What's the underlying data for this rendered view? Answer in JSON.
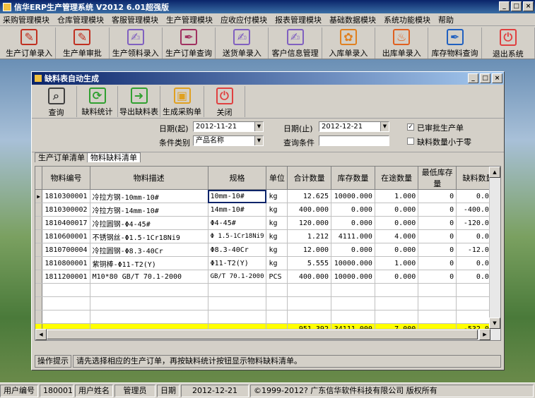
{
  "app": {
    "title": "信华ERP生产管理系统 V2012 6.01超强版"
  },
  "menu": [
    "采购管理模块",
    "仓库管理模块",
    "客服管理模块",
    "生产管理模块",
    "应收应付模块",
    "报表管理模块",
    "基础数据模块",
    "系统功能模块",
    "帮助"
  ],
  "toolbar": [
    {
      "label": "生产订单录入",
      "icon": "pdf-icon",
      "color": "#c03020"
    },
    {
      "label": "生产单审批",
      "icon": "pdf-icon",
      "color": "#c03020"
    },
    {
      "label": "生产领料录入",
      "icon": "document-pen-icon",
      "color": "#8060c0"
    },
    {
      "label": "生产订单查询",
      "icon": "pen-icon",
      "color": "#a03060"
    },
    {
      "label": "送货单录入",
      "icon": "document-pen-icon",
      "color": "#8060c0"
    },
    {
      "label": "客户信息管理",
      "icon": "document-pen-icon",
      "color": "#8060c0"
    },
    {
      "label": "入库单录入",
      "icon": "flower-icon",
      "color": "#e08020"
    },
    {
      "label": "出库单录入",
      "icon": "flame-icon",
      "color": "#e06020"
    },
    {
      "label": "库存物料查询",
      "icon": "quill-icon",
      "color": "#2060c0"
    },
    {
      "label": "退出系统",
      "icon": "power-icon",
      "color": "#e04040"
    }
  ],
  "child": {
    "title": "缺料表自动生成",
    "toolbar": [
      {
        "label": "查询",
        "icon": "magnifier-icon",
        "color": "#404040"
      },
      {
        "label": "缺料统计",
        "icon": "refresh-icon",
        "color": "#30a030"
      },
      {
        "label": "导出缺料表",
        "icon": "arrow-right-icon",
        "color": "#30a030"
      },
      {
        "label": "生成采购单",
        "icon": "box-icon",
        "color": "#e0a020"
      },
      {
        "label": "关闭",
        "icon": "power-icon",
        "color": "#e04040"
      }
    ],
    "filter": {
      "date_from_label": "日期(起)",
      "date_from": "2012-11-21",
      "date_to_label": "日期(止)",
      "date_to": "2012-12-21",
      "cond_type_label": "条件类别",
      "cond_type": "产品名称",
      "cond_label": "查询条件",
      "cond": "",
      "approved_label": "已审批生产单",
      "approved": true,
      "short_label": "缺料数量小于零",
      "short": false
    },
    "tabs": [
      "生产订单清单",
      "物料缺料清单"
    ],
    "columns": [
      "物料编号",
      "物料描述",
      "规格",
      "单位",
      "合计数量",
      "库存数量",
      "在途数量",
      "最低库存量",
      "缺料数量"
    ],
    "rows": [
      [
        "1810300001",
        "冷拉方钢-10mm-10#",
        "10mm-10#",
        "kg",
        "12.625",
        "10000.000",
        "1.000",
        "0",
        "0.000"
      ],
      [
        "1810300002",
        "冷拉方钢-14mm-10#",
        "14mm-10#",
        "kg",
        "400.000",
        "0.000",
        "0.000",
        "0",
        "-400.000"
      ],
      [
        "1810400017",
        "冷拉圆钢-Φ4-45#",
        "Φ4-45#",
        "kg",
        "120.000",
        "0.000",
        "0.000",
        "0",
        "-120.000"
      ],
      [
        "1810600001",
        "不锈钢丝-Φ1.5-1Cr18Ni9",
        "Φ 1.5-1Cr18Ni9",
        "kg",
        "1.212",
        "4111.000",
        "4.000",
        "0",
        "0.000"
      ],
      [
        "1810700004",
        "冷拉圆钢-Φ8.3-40Cr",
        "Φ8.3-40Cr",
        "kg",
        "12.000",
        "0.000",
        "0.000",
        "0",
        "-12.000"
      ],
      [
        "1810800001",
        "紫铜棒-Φ11-T2(Y)",
        "Φ11-T2(Y)",
        "kg",
        "5.555",
        "10000.000",
        "1.000",
        "0",
        "0.000"
      ],
      [
        "1811200001",
        "M10*80 GB/T 70.1-2000",
        "GB/T 70.1-2000",
        "PCS",
        "400.000",
        "10000.000",
        "0.000",
        "0",
        "0.000"
      ]
    ],
    "totals": [
      "951.392",
      "34111.000",
      "7.000",
      "-532.000"
    ],
    "hint_label": "操作提示",
    "hint_text": "请先选择相应的生产订单，再按缺料统计按钮显示物料缺料清单。"
  },
  "status": {
    "user_id_label": "用户编号",
    "user_id": "180001",
    "user_name_label": "用户姓名",
    "user_name": "管理员",
    "date_label": "日期",
    "date": "2012-12-21",
    "copyright": "©1999-2012? 广东信华软件科技有限公司 版权所有"
  },
  "chart_data": {
    "type": "table",
    "columns": [
      "物料编号",
      "物料描述",
      "规格",
      "单位",
      "合计数量",
      "库存数量",
      "在途数量",
      "最低库存量",
      "缺料数量"
    ],
    "rows": [
      [
        "1810300001",
        "冷拉方钢-10mm-10#",
        "10mm-10#",
        "kg",
        12.625,
        10000,
        1,
        0,
        0
      ],
      [
        "1810300002",
        "冷拉方钢-14mm-10#",
        "14mm-10#",
        "kg",
        400,
        0,
        0,
        0,
        -400
      ],
      [
        "1810400017",
        "冷拉圆钢-Φ4-45#",
        "Φ4-45#",
        "kg",
        120,
        0,
        0,
        0,
        -120
      ],
      [
        "1810600001",
        "不锈钢丝-Φ1.5-1Cr18Ni9",
        "Φ 1.5-1Cr18Ni9",
        "kg",
        1.212,
        4111,
        4,
        0,
        0
      ],
      [
        "1810700004",
        "冷拉圆钢-Φ8.3-40Cr",
        "Φ8.3-40Cr",
        "kg",
        12,
        0,
        0,
        0,
        -12
      ],
      [
        "1810800001",
        "紫铜棒-Φ11-T2(Y)",
        "Φ11-T2(Y)",
        "kg",
        5.555,
        10000,
        1,
        0,
        0
      ],
      [
        "1811200001",
        "M10*80 GB/T 70.1-2000",
        "GB/T 70.1-2000",
        "PCS",
        400,
        10000,
        0,
        0,
        0
      ]
    ],
    "totals": {
      "合计数量": 951.392,
      "库存数量": 34111,
      "在途数量": 7,
      "缺料数量": -532
    }
  }
}
